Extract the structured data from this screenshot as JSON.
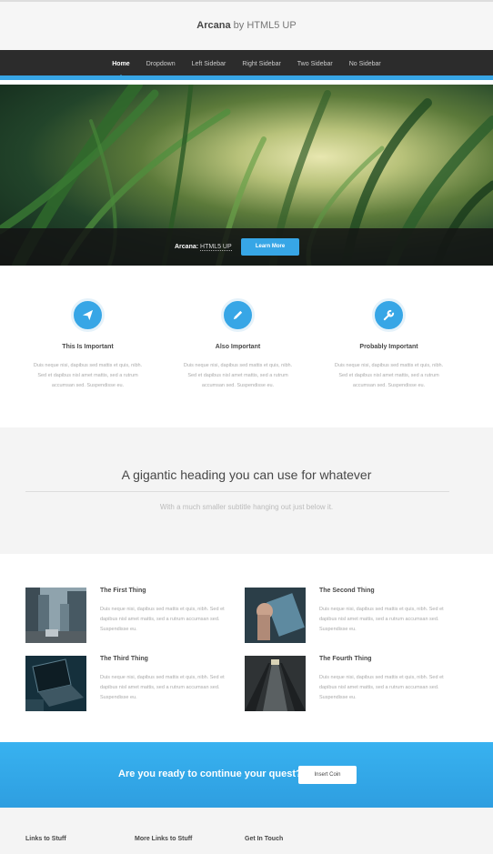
{
  "header": {
    "brand": "Arcana",
    "by_text": "by HTML5 UP"
  },
  "nav": {
    "items": [
      "Home",
      "Dropdown",
      "Left Sidebar",
      "Right Sidebar",
      "Two Sidebar",
      "No Sidebar"
    ]
  },
  "banner": {
    "label_bold": "Arcana:",
    "label_link": "HTML5 UP",
    "button": "Learn More"
  },
  "features": [
    {
      "icon": "paper-plane-icon",
      "title": "This Is Important",
      "text": "Duis neque nisi, dapibus sed mattis et quis, nibh. Sed et dapibus nisl amet mattis, sed a rutrum accumsan sed. Suspendisse eu."
    },
    {
      "icon": "pencil-icon",
      "title": "Also Important",
      "text": "Duis neque nisi, dapibus sed mattis et quis, nibh. Sed et dapibus nisl amet mattis, sed a rutrum accumsan sed. Suspendisse eu."
    },
    {
      "icon": "wrench-icon",
      "title": "Probably Important",
      "text": "Duis neque nisi, dapibus sed mattis et quis, nibh. Sed et dapibus nisl amet mattis, sed a rutrum accumsan sed. Suspendisse eu."
    }
  ],
  "giant": {
    "heading": "A gigantic heading you can use for whatever",
    "subtitle": "With a much smaller subtitle hanging out just below it."
  },
  "things": [
    {
      "title": "The First Thing",
      "text": "Duis neque nisi, dapibus sed mattis et quis, nibh. Sed et dapibus nisl amet mattis, sed a rutrum accumsan sed. Suspendisse eu."
    },
    {
      "title": "The Second Thing",
      "text": "Duis neque nisi, dapibus sed mattis et quis, nibh. Sed et dapibus nisl amet mattis, sed a rutrum accumsan sed. Suspendisse eu."
    },
    {
      "title": "The Third Thing",
      "text": "Duis neque nisi, dapibus sed mattis et quis, nibh. Sed et dapibus nisl amet mattis, sed a rutrum accumsan sed. Suspendisse eu."
    },
    {
      "title": "The Fourth Thing",
      "text": "Duis neque nisi, dapibus sed mattis et quis, nibh. Sed et dapibus nisl amet mattis, sed a rutrum accumsan sed. Suspendisse eu."
    }
  ],
  "cta": {
    "heading": "Are you ready to continue your quest?",
    "button": "Insert Coin"
  },
  "footer": {
    "columns": [
      "Links to Stuff",
      "More Links to Stuff",
      "Get In Touch"
    ]
  },
  "colors": {
    "accent": "#37a6e6",
    "nav_bg": "#2c2c2c",
    "text": "#474747"
  }
}
